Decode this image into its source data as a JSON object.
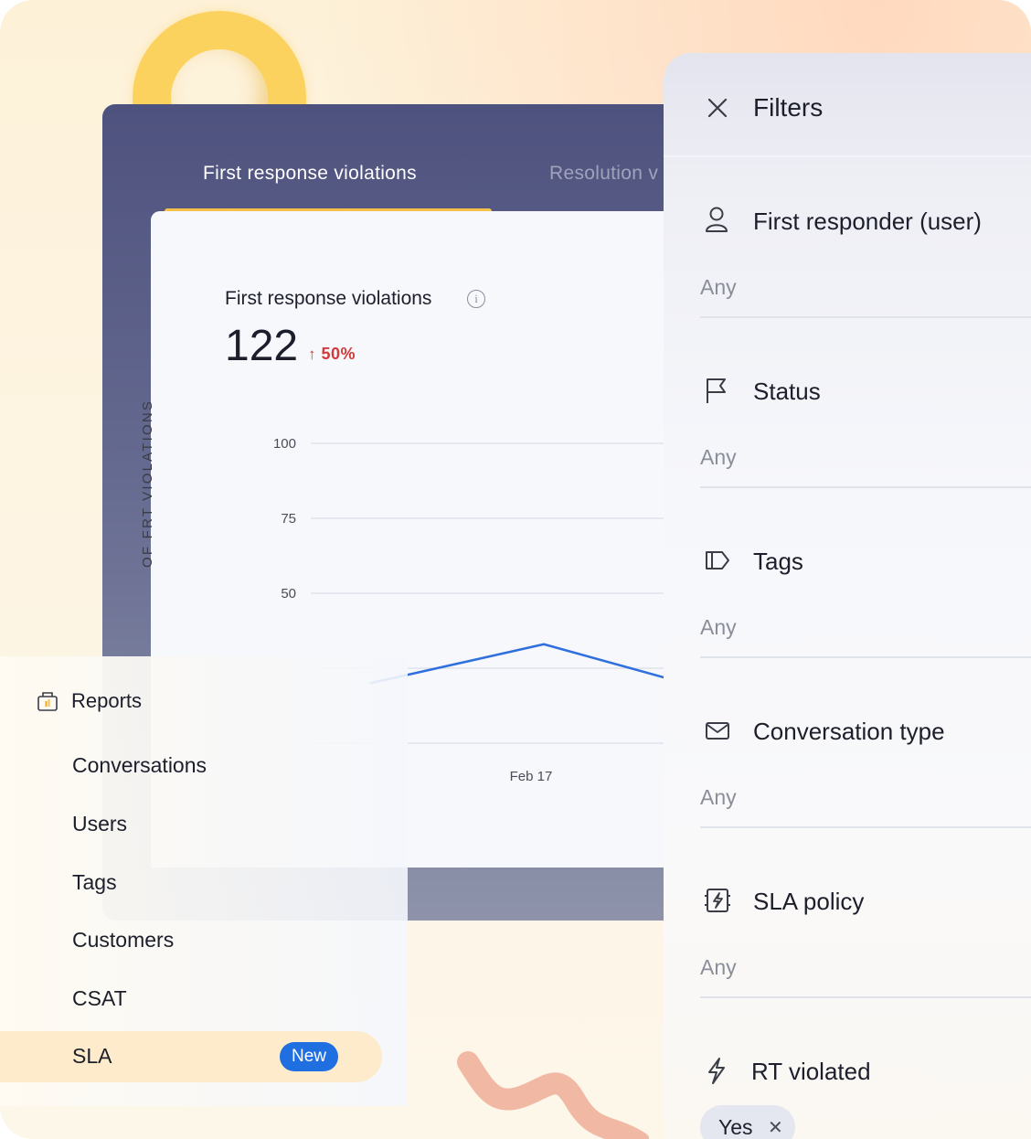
{
  "dashboard": {
    "tabs": [
      {
        "label": "First response violations"
      },
      {
        "label": "Resolution v"
      }
    ],
    "card": {
      "title": "First response violations",
      "value": "122",
      "delta": "50%",
      "y_axis_label": "OF FRT VIOLATIONS"
    }
  },
  "chart_data": {
    "type": "line",
    "title": "",
    "ylabel": "OF FRT VIOLATIONS",
    "yticks": [
      "100",
      "75",
      "50"
    ],
    "ylim": [
      0,
      100
    ],
    "x_ticks": [
      "Feb 17"
    ],
    "series": [
      {
        "color": "#2f6fde",
        "points": [
          [
            0,
            20
          ],
          [
            0.5,
            33
          ],
          [
            1,
            17
          ]
        ]
      }
    ]
  },
  "nav": {
    "header": "Reports",
    "items": [
      "Conversations",
      "Users",
      "Tags",
      "Customers",
      "CSAT"
    ],
    "active": {
      "label": "SLA",
      "badge": "New"
    }
  },
  "filters": {
    "title": "Filters",
    "rows": [
      {
        "label": "First responder (user)",
        "value": "Any",
        "icon": "user-icon"
      },
      {
        "label": "Status",
        "value": "Any",
        "icon": "flag-icon"
      },
      {
        "label": "Tags",
        "value": "Any",
        "icon": "tag-icon"
      },
      {
        "label": "Conversation type",
        "value": "Any",
        "icon": "envelope-icon"
      },
      {
        "label": "SLA policy",
        "value": "Any",
        "icon": "sla-policy-icon"
      }
    ],
    "rt_violated": {
      "label": "RT violated",
      "icon": "lightning-icon",
      "chip": "Yes"
    }
  },
  "colors": {
    "accent": "#f5c14a",
    "badge": "#1f6fe0",
    "line": "#2f6fde",
    "delta": "#d23a3a"
  }
}
